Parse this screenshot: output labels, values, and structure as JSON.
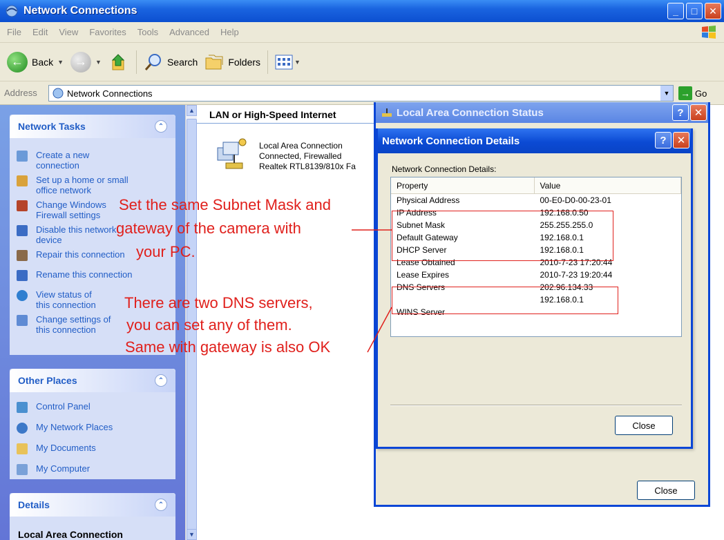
{
  "window": {
    "title": "Network Connections",
    "buttons": [
      "_",
      "□",
      "X"
    ]
  },
  "menu": {
    "items": [
      "File",
      "Edit",
      "View",
      "Favorites",
      "Tools",
      "Advanced",
      "Help"
    ]
  },
  "toolbar": {
    "back_label": "Back",
    "search_label": "Search",
    "folders_label": "Folders"
  },
  "address": {
    "label": "Address",
    "value": "Network Connections",
    "go_label": "Go"
  },
  "sidebar": {
    "network_tasks": {
      "title": "Network Tasks",
      "items": [
        {
          "label": "Create a new connection",
          "icon": "new-connection-icon"
        },
        {
          "label": "Set up a home or small office network",
          "icon": "home-network-icon"
        },
        {
          "label": "Change Windows Firewall settings",
          "icon": "firewall-icon"
        },
        {
          "label": "Disable this network device",
          "icon": "disable-device-icon"
        },
        {
          "label": "Repair this connection",
          "icon": "repair-icon"
        },
        {
          "label": "Rename this connection",
          "icon": "rename-icon"
        },
        {
          "label": "View status of this connection",
          "icon": "status-icon"
        },
        {
          "label": "Change settings of this connection",
          "icon": "settings-icon"
        }
      ]
    },
    "other_places": {
      "title": "Other Places",
      "items": [
        {
          "label": "Control Panel",
          "icon": "control-panel-icon"
        },
        {
          "label": "My Network Places",
          "icon": "network-places-icon"
        },
        {
          "label": "My Documents",
          "icon": "documents-icon"
        },
        {
          "label": "My Computer",
          "icon": "computer-icon"
        }
      ]
    },
    "details": {
      "title": "Details",
      "subtitle": "Local Area Connection"
    }
  },
  "main": {
    "group_title": "LAN or High-Speed Internet",
    "connection": {
      "name": "Local Area Connection",
      "status": "Connected, Firewalled",
      "adapter": "Realtek RTL8139/810x Fa"
    }
  },
  "status_dialog": {
    "title": "Local Area Connection Status",
    "close_label": "Close"
  },
  "details_dialog": {
    "title": "Network Connection Details",
    "label": "Network Connection Details:",
    "columns": [
      "Property",
      "Value"
    ],
    "rows": [
      [
        "Physical Address",
        "00-E0-D0-00-23-01"
      ],
      [
        "IP Address",
        "192.168.0.50"
      ],
      [
        "Subnet Mask",
        "255.255.255.0"
      ],
      [
        "Default Gateway",
        "192.168.0.1"
      ],
      [
        "DHCP Server",
        "192.168.0.1"
      ],
      [
        "Lease Obtained",
        "2010-7-23 17:20:44"
      ],
      [
        "Lease Expires",
        "2010-7-23 19:20:44"
      ],
      [
        "DNS Servers",
        "202.96.134.33"
      ],
      [
        "",
        "192.168.0.1"
      ],
      [
        "WINS Server",
        ""
      ]
    ],
    "close_label": "Close"
  },
  "annotations": {
    "note1": [
      "Set the same Subnet Mask and",
      "gateway of the camera with",
      "your PC."
    ],
    "note2": [
      "There are two DNS servers,",
      "you can set any of them.",
      "Same with gateway is also OK"
    ],
    "color": "#e0201c"
  }
}
